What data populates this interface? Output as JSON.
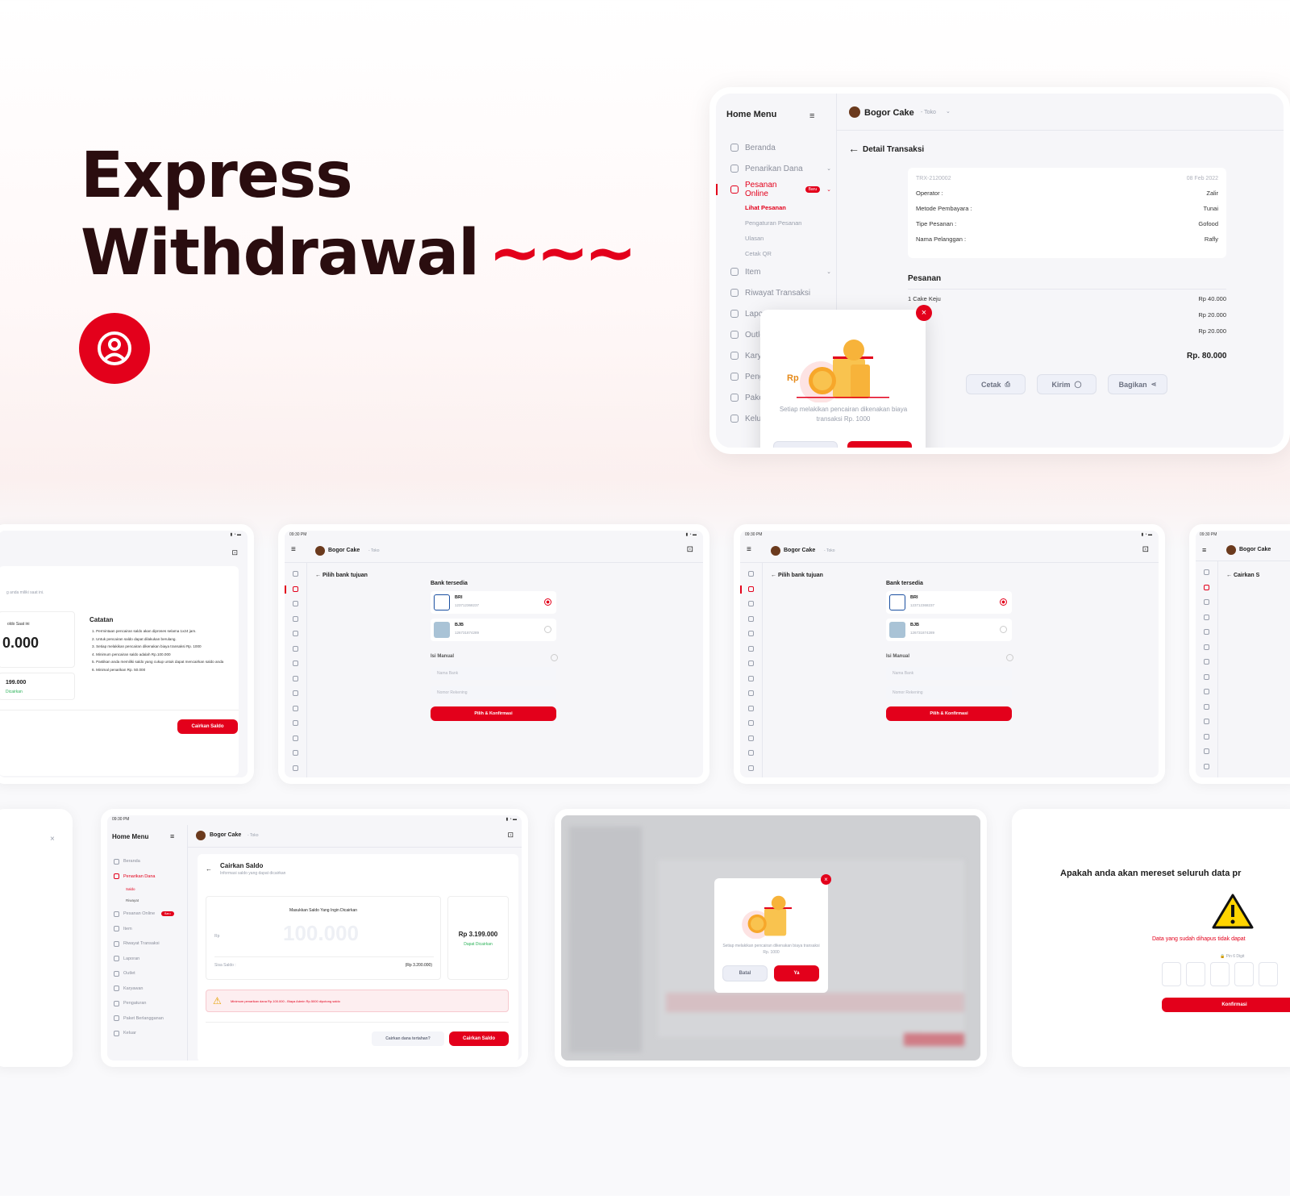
{
  "hero": {
    "title_line1": "Express",
    "title_line2": "Withdrawal",
    "tilde": "~~~",
    "logo_icon": "user-circle-icon"
  },
  "colors": {
    "accent": "#e3001b",
    "dark": "#2a0d0f",
    "bg": "#f6f6f9"
  },
  "main": {
    "sidebar_title": "Home Menu",
    "store_name": "Bogor Cake",
    "store_type": "- Toko",
    "menu": [
      {
        "label": "Beranda",
        "icon": "grid-icon"
      },
      {
        "label": "Penarikan Dana",
        "icon": "withdraw-icon"
      },
      {
        "label": "Pesanan Online",
        "icon": "order-icon",
        "badge": "Baru"
      },
      {
        "label": "Item",
        "icon": "item-icon"
      },
      {
        "label": "Riwayat Transaksi",
        "icon": "history-icon"
      },
      {
        "label": "Laporan",
        "icon": "report-icon"
      },
      {
        "label": "Outlet",
        "icon": "outlet-icon"
      },
      {
        "label": "Karyawan",
        "icon": "employee-icon"
      },
      {
        "label": "Pengaturan",
        "icon": "settings-icon"
      },
      {
        "label": "Paket Berlangganan",
        "icon": "package-icon"
      },
      {
        "label": "Keluar",
        "icon": "logout-icon"
      }
    ],
    "submenu": [
      "Lihat Pesanan",
      "Pengaturan Pesanan",
      "Ulasan",
      "Cetak QR"
    ],
    "detail_title": "Detail Transaksi",
    "trx_id": "TRX-2120002",
    "trx_date": "08 Feb 2022",
    "info": [
      {
        "label": "Operator :",
        "value": "Zalir"
      },
      {
        "label": "Metode Pembayara :",
        "value": "Tunai"
      },
      {
        "label": "Tipe Pesanan :",
        "value": "Gofood"
      },
      {
        "label": "Nama Pelanggan :",
        "value": "Rafly"
      }
    ],
    "pesanan_title": "Pesanan",
    "orders": [
      {
        "name": "1 Cake Keju",
        "price": "Rp 40.000"
      },
      {
        "name": "",
        "price": "Rp 20.000"
      },
      {
        "name": "",
        "price": "Rp 20.000"
      }
    ],
    "total": "Rp. 80.000",
    "actions": [
      "Cetak",
      "Kirim",
      "Bagikan"
    ],
    "modal": {
      "text": "Setiap melakikan pencairan dikenakan biaya transaksi Rp. 1000",
      "cancel": "Batal",
      "ok": "Ya",
      "coin": "Rp"
    }
  },
  "row2": {
    "time": "09:30 PM",
    "s1": {
      "intro": "g anda miliki saat ini.",
      "notes_title": "Catatan",
      "saldo_label": "oldo Saat ini",
      "saldo_value": "0.000",
      "saldo2": "199.000",
      "saldo2_label": "Dicairkan",
      "notes": [
        "1. Permintaan pencairan saldo akan diproses selama 1x24 jam.",
        "2. Untuk pencairan saldo dapat dilakukan berulang.",
        "3. Setiap melakikan pencairan dikenakan biaya transaksi Rp. 1000",
        "4. Minimum pencairan saldo adalah Rp.100.000",
        "5. Pastikan anda memiliki saldo yang cukup untuk dapat mencairkan saldo anda",
        "6. Minimal penarikan Rp. 50.000"
      ],
      "button": "Cairkan Saldo"
    },
    "bank": {
      "back_title": "Pilih bank tujuan",
      "available": "Bank tersedia",
      "banks": [
        {
          "name": "BRI",
          "acct": "123712368237"
        },
        {
          "name": "BJB",
          "acct": "126731874289"
        }
      ],
      "manual": "Isi Manual",
      "ph_bank": "Nama Bank",
      "ph_rek": "Nomor Rekening",
      "button": "Pilih & Konfirmasi"
    },
    "s4": {
      "title": "Cairkan S"
    }
  },
  "row3": {
    "cair": {
      "title": "Cairkan Saldo",
      "subtitle": "Informasi saldo yang dapat dicairkan",
      "input_label": "Masukkan Saldo Yang Ingin Dicairkan",
      "currency": "Rp",
      "placeholder": "100.000",
      "sisa": "Sisa Saldo :",
      "sisa_value": "(Rp 3.200.000)",
      "balance": "Rp 3.199.000",
      "balance_label": "Dapat Dicairkan",
      "warning": "Minimum penarikan dana Rp.100.000 - Biaya Admin Rp.5000 dipotong saldo",
      "question": "Cairkan dana tertahan?",
      "button": "Cairkan Saldo",
      "submenu": [
        "Saldo",
        "Riwayat"
      ]
    },
    "reset": {
      "question": "Apakah anda akan mereset seluruh data pr",
      "warning": "Data yang sudah dihapus tidak dapat",
      "pin": "Pin 6 Digit",
      "button": "Konfirmasi"
    }
  }
}
